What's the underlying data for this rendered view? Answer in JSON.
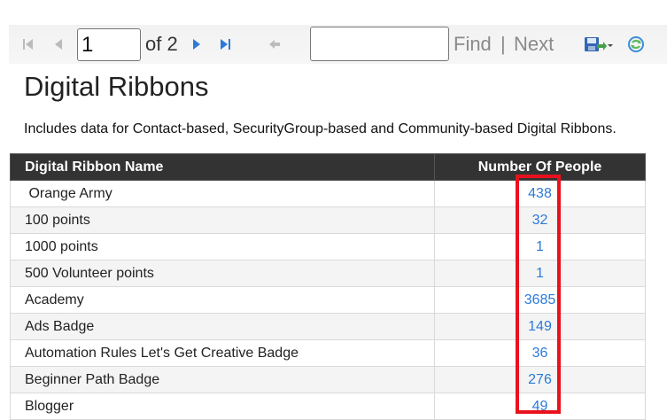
{
  "toolbar": {
    "page_value": "1",
    "of_pages": "of 2",
    "find_value": "",
    "find_label": "Find",
    "separator": "|",
    "next_label": "Next",
    "icons": [
      "first-page-icon",
      "prev-page-icon",
      "next-page-icon",
      "last-page-icon",
      "back-icon",
      "export-icon",
      "refresh-icon"
    ]
  },
  "report": {
    "title": "Digital Ribbons",
    "description": "Includes data for Contact-based, SecurityGroup-based and Community-based Digital Ribbons.",
    "columns": [
      "Digital Ribbon Name",
      "Number Of People"
    ],
    "rows": [
      {
        "name": " Orange Army",
        "count": "438"
      },
      {
        "name": "100 points",
        "count": "32"
      },
      {
        "name": "1000 points",
        "count": "1"
      },
      {
        "name": "500 Volunteer points",
        "count": "1"
      },
      {
        "name": "Academy",
        "count": "3685"
      },
      {
        "name": "Ads Badge",
        "count": "149"
      },
      {
        "name": "Automation Rules Let's Get Creative Badge",
        "count": "36"
      },
      {
        "name": "Beginner Path Badge",
        "count": "276"
      },
      {
        "name": "Blogger",
        "count": "49"
      }
    ]
  },
  "colors": {
    "header_bg": "#333333",
    "link": "#2a7ad9",
    "highlight": "#e8121d"
  }
}
